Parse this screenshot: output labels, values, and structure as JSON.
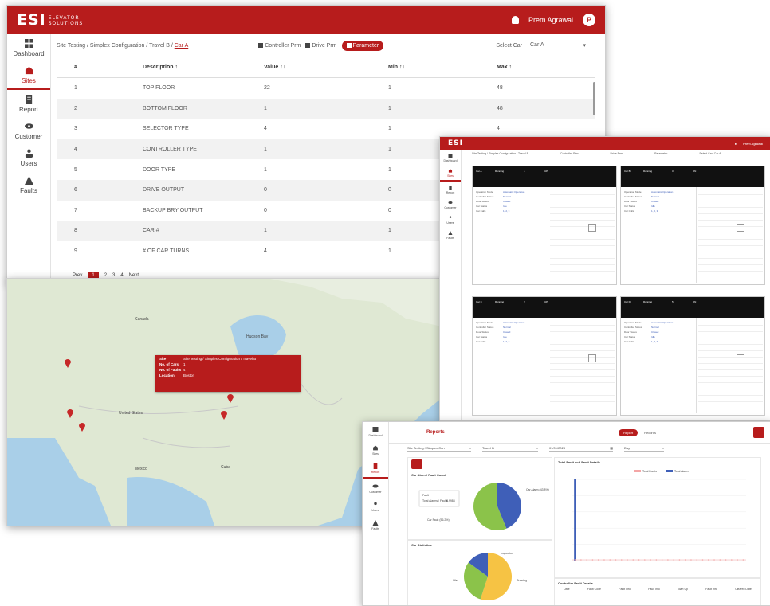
{
  "app": {
    "logo_text": "ESI",
    "logo_sub_1": "ELEVATOR",
    "logo_sub_2": "SOLUTIONS",
    "user_name": "Prem Agrawal",
    "user_initial": "P"
  },
  "sidebar": [
    {
      "label": "Dashboard",
      "icon": "grid-icon"
    },
    {
      "label": "Sites",
      "icon": "building-icon"
    },
    {
      "label": "Report",
      "icon": "document-icon"
    },
    {
      "label": "Customer",
      "icon": "eye-icon"
    },
    {
      "label": "Users",
      "icon": "users-icon"
    },
    {
      "label": "Faults",
      "icon": "warning-icon"
    }
  ],
  "params": {
    "breadcrumb": "Site Testing / Simplex Configuration / Travel B /",
    "breadcrumb_link": "Car A",
    "tabs": [
      "Controller Prm",
      "Drive Prm",
      "Parameter"
    ],
    "select_car_label": "Select Car",
    "select_car_value": "Car A",
    "columns": [
      "#",
      "Description ↑↓",
      "Value ↑↓",
      "Min ↑↓",
      "Max ↑↓"
    ],
    "rows": [
      [
        "1",
        "TOP FLOOR",
        "22",
        "1",
        "48"
      ],
      [
        "2",
        "BOTTOM FLOOR",
        "1",
        "1",
        "48"
      ],
      [
        "3",
        "SELECTOR TYPE",
        "4",
        "1",
        "4"
      ],
      [
        "4",
        "CONTROLLER TYPE",
        "1",
        "1",
        "4"
      ],
      [
        "5",
        "DOOR TYPE",
        "1",
        "1",
        "4"
      ],
      [
        "6",
        "DRIVE OUTPUT",
        "0",
        "0",
        "1"
      ],
      [
        "7",
        "BACKUP BRY OUTPUT",
        "0",
        "0",
        "1"
      ],
      [
        "8",
        "CAR #",
        "1",
        "1",
        "8"
      ],
      [
        "9",
        "# OF CAR TURNS",
        "4",
        "1",
        "8"
      ]
    ],
    "pager": {
      "prev": "Prev",
      "pages": [
        "1",
        "2",
        "3",
        "4"
      ],
      "current": "1",
      "next": "Next"
    }
  },
  "map": {
    "labels": [
      "Canada",
      "United States",
      "Mexico",
      "Cuba",
      "Hudson Bay"
    ],
    "tooltip": [
      {
        "key": "Site",
        "value": "Site Testing / Simplex Configuration / Travel B"
      },
      {
        "key": "No. of Cars",
        "value": "1"
      },
      {
        "key": "No. of Faults",
        "value": "4"
      },
      {
        "key": "Location",
        "value": "Boston"
      }
    ],
    "pin_color": "#c62828"
  },
  "grid": {
    "toolbar": [
      "Site Testing / Simplex Configuration / Travel B",
      "Controller Prm",
      "Drive Prm",
      "Parameter",
      "Select Car: Car A"
    ],
    "panels": [
      {
        "car": "Car A",
        "status": "Running",
        "floor": "1",
        "dir": "UP"
      },
      {
        "car": "Car B",
        "status": "Running",
        "floor": "3",
        "dir": "DN"
      },
      {
        "car": "Car C",
        "status": "Running",
        "floor": "2",
        "dir": "UP"
      },
      {
        "car": "Car D",
        "status": "Running",
        "floor": "5",
        "dir": "DN"
      }
    ],
    "field_labels": [
      "Operation Mode",
      "Controller Status",
      "Door Status",
      "Car Status",
      "Car Calls"
    ],
    "field_values": [
      "Automatic Operation",
      "Normal",
      "Closed",
      "Idle",
      "1, 2, 3"
    ]
  },
  "reports": {
    "title": "Reports",
    "buttons": [
      "Report",
      "Records"
    ],
    "filters": [
      "Site Testing / Simplex Con",
      "Travel B",
      "01/01/2023",
      "Day"
    ],
    "cards": {
      "pie1_title": "Car Alarm/ Fault Count",
      "pie1_tooltip": [
        "Fault",
        "Total Alarms / Faults",
        "8,9984"
      ],
      "pie1_label_a": "Car Alarm (43.8%)",
      "pie1_label_b": "Car Fault (56.2%)",
      "pie2_title": "Car Statistics",
      "pie2_labels": [
        "Idle",
        "Running",
        "Inspection"
      ],
      "bar_title": "Total Fault and Fault Details",
      "bar_legend": [
        "Total Faults",
        "Total Alarms"
      ],
      "bottom_title": "Controller Fault Details",
      "bottom_cols": [
        "Date",
        "Fault Code",
        "Fault Info",
        "Fault Info",
        "Start Up",
        "Fault Info",
        "Cleared Date"
      ]
    },
    "chart_data": {
      "type": "bar",
      "series": [
        {
          "name": "Total Faults",
          "values": [
            0,
            0,
            0,
            0,
            0,
            0,
            0,
            0,
            0,
            0,
            0,
            0,
            0,
            0,
            0,
            0,
            0,
            0,
            0,
            0,
            0,
            0,
            0,
            0,
            0,
            0,
            0,
            0,
            0,
            0
          ]
        },
        {
          "name": "Total Alarms",
          "values": [
            120,
            0,
            0,
            0,
            0,
            0,
            0,
            0,
            0,
            0,
            0,
            0,
            0,
            0,
            0,
            0,
            0,
            0,
            0,
            0,
            0,
            0,
            0,
            0,
            0,
            0,
            0,
            0,
            0,
            0
          ]
        }
      ]
    },
    "pie1_data": [
      {
        "label": "Car Alarm",
        "value": 43.8,
        "color": "#3f5fb8"
      },
      {
        "label": "Car Fault",
        "value": 56.2,
        "color": "#8bc34a"
      }
    ],
    "pie2_data": [
      {
        "label": "Idle",
        "value": 55,
        "color": "#f6c344"
      },
      {
        "label": "Running",
        "value": 30,
        "color": "#8bc34a"
      },
      {
        "label": "Inspection",
        "value": 15,
        "color": "#3f5fb8"
      }
    ]
  },
  "colors": {
    "brand": "#b71c1c",
    "map_water": "#a9cfe8",
    "map_land": "#dfe8d3"
  }
}
